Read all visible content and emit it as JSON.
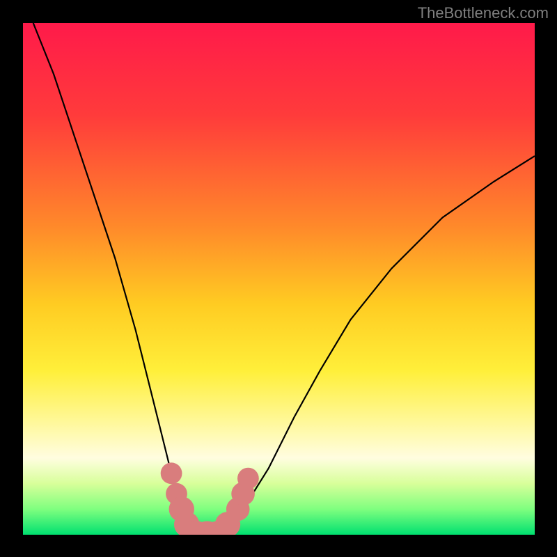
{
  "watermark": "TheBottleneck.com",
  "chart_data": {
    "type": "line",
    "title": "",
    "xlabel": "",
    "ylabel": "",
    "xlim": [
      0,
      100
    ],
    "ylim": [
      0,
      100
    ],
    "gradient_stops": [
      {
        "offset": 0,
        "color": "#ff1a4a"
      },
      {
        "offset": 18,
        "color": "#ff3b3b"
      },
      {
        "offset": 40,
        "color": "#ff8a2a"
      },
      {
        "offset": 55,
        "color": "#ffcc22"
      },
      {
        "offset": 68,
        "color": "#ffef3a"
      },
      {
        "offset": 78,
        "color": "#fff89a"
      },
      {
        "offset": 85,
        "color": "#fffde0"
      },
      {
        "offset": 90,
        "color": "#d8ff9a"
      },
      {
        "offset": 95,
        "color": "#7fff7f"
      },
      {
        "offset": 100,
        "color": "#00e070"
      }
    ],
    "series": [
      {
        "name": "bottleneck-curve",
        "x": [
          2,
          6,
          10,
          14,
          18,
          22,
          25,
          27,
          29,
          31,
          33,
          35,
          37,
          39,
          43,
          48,
          53,
          58,
          64,
          72,
          82,
          92,
          100
        ],
        "y": [
          100,
          90,
          78,
          66,
          54,
          40,
          28,
          20,
          12,
          6,
          2,
          0,
          0,
          1,
          5,
          13,
          23,
          32,
          42,
          52,
          62,
          69,
          74
        ]
      }
    ],
    "markers": {
      "name": "highlight-dots",
      "color": "#d97d7d",
      "points": [
        {
          "x": 29,
          "y": 12,
          "r": 2.2
        },
        {
          "x": 30,
          "y": 8,
          "r": 2.2
        },
        {
          "x": 31,
          "y": 5,
          "r": 2.6
        },
        {
          "x": 32,
          "y": 2,
          "r": 2.6
        },
        {
          "x": 34,
          "y": 0,
          "r": 2.8
        },
        {
          "x": 36,
          "y": 0,
          "r": 2.8
        },
        {
          "x": 38,
          "y": 0,
          "r": 2.8
        },
        {
          "x": 40,
          "y": 2,
          "r": 2.6
        },
        {
          "x": 42,
          "y": 5,
          "r": 2.4
        },
        {
          "x": 43,
          "y": 8,
          "r": 2.4
        },
        {
          "x": 44,
          "y": 11,
          "r": 2.2
        }
      ]
    }
  }
}
